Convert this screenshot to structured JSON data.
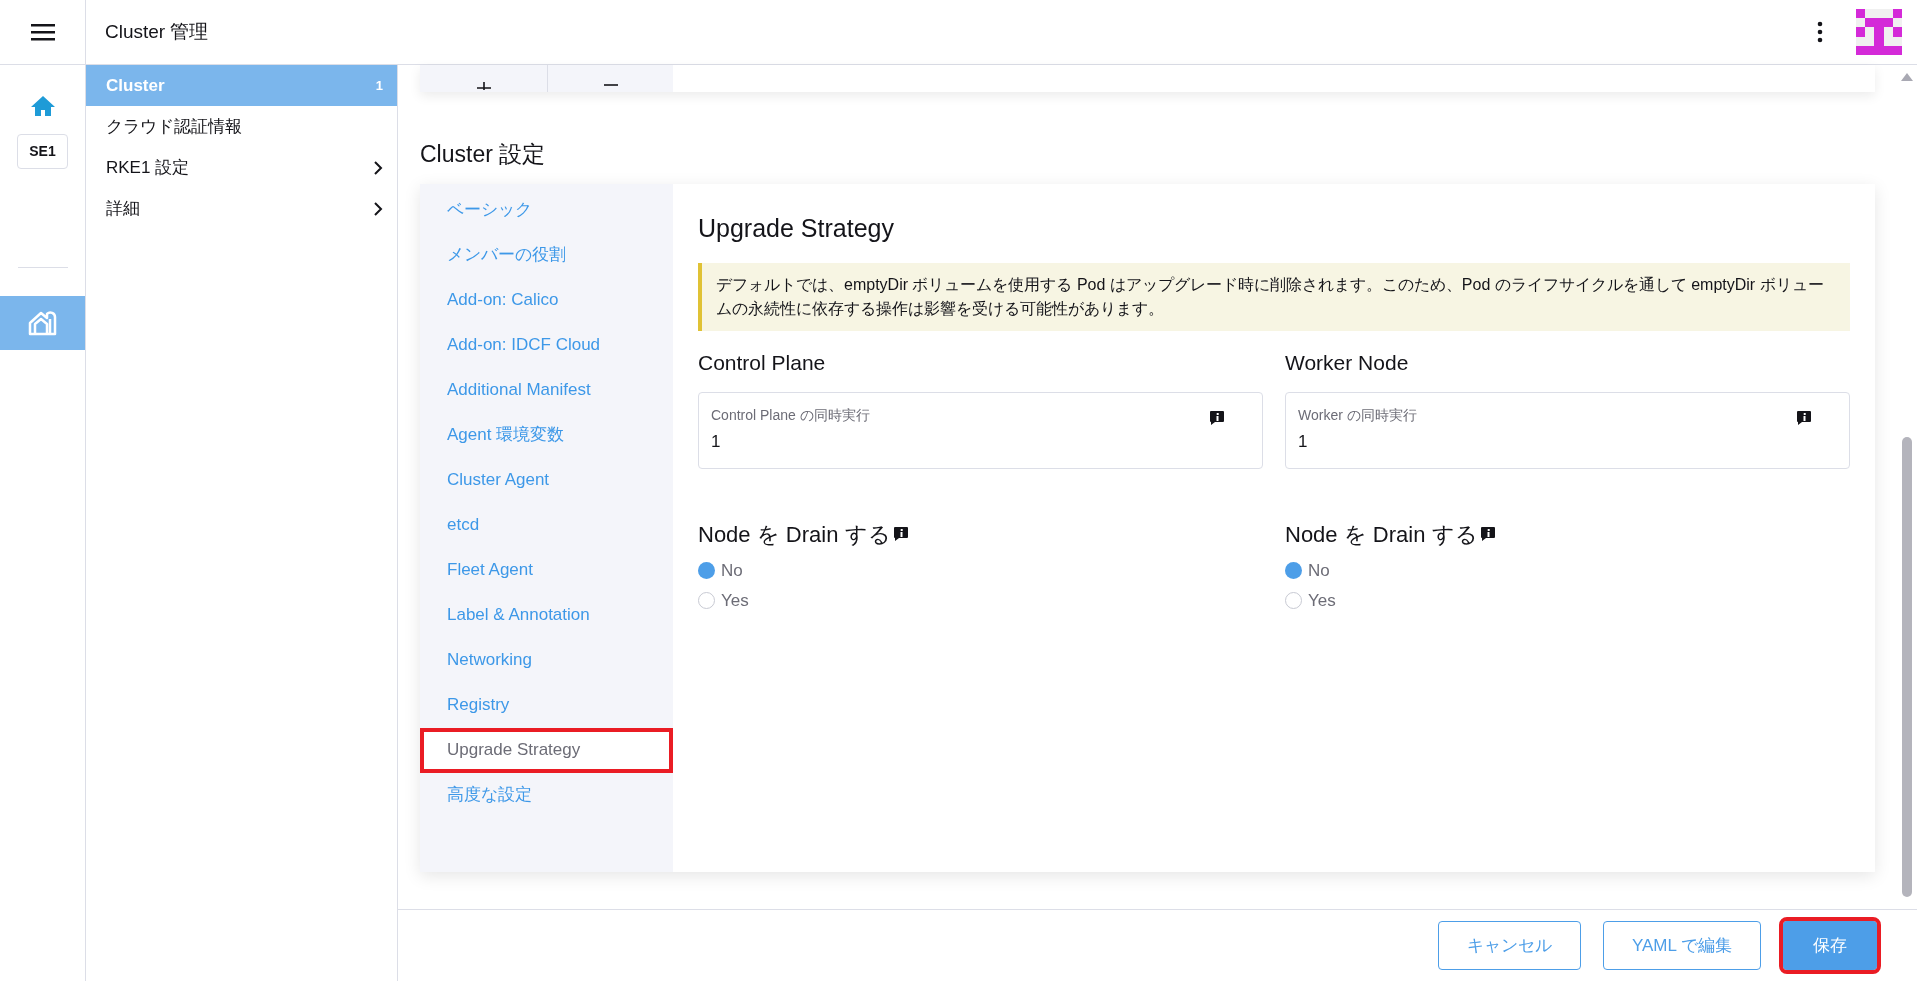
{
  "header": {
    "title": "Cluster 管理"
  },
  "rail": {
    "cluster_badge": "SE1"
  },
  "sidebar": {
    "items": [
      {
        "label": "Cluster",
        "count": "1",
        "selected": true,
        "expandable": false
      },
      {
        "label": "クラウド認証情報",
        "selected": false,
        "expandable": false
      },
      {
        "label": "RKE1 設定",
        "selected": false,
        "expandable": true
      },
      {
        "label": "詳細",
        "selected": false,
        "expandable": true
      }
    ]
  },
  "section_title": "Cluster 設定",
  "settings_nav": [
    {
      "label": "ベーシック",
      "selected": false,
      "highlighted": false
    },
    {
      "label": "メンバーの役割",
      "selected": false,
      "highlighted": false
    },
    {
      "label": "Add-on: Calico",
      "selected": false,
      "highlighted": false
    },
    {
      "label": "Add-on: IDCF Cloud",
      "selected": false,
      "highlighted": false
    },
    {
      "label": "Additional Manifest",
      "selected": false,
      "highlighted": false
    },
    {
      "label": "Agent 環境変数",
      "selected": false,
      "highlighted": false
    },
    {
      "label": "Cluster Agent",
      "selected": false,
      "highlighted": false
    },
    {
      "label": "etcd",
      "selected": false,
      "highlighted": false
    },
    {
      "label": "Fleet Agent",
      "selected": false,
      "highlighted": false
    },
    {
      "label": "Label & Annotation",
      "selected": false,
      "highlighted": false
    },
    {
      "label": "Networking",
      "selected": false,
      "highlighted": false
    },
    {
      "label": "Registry",
      "selected": false,
      "highlighted": false
    },
    {
      "label": "Upgrade Strategy",
      "selected": true,
      "highlighted": true
    },
    {
      "label": "高度な設定",
      "selected": false,
      "highlighted": false
    }
  ],
  "panel": {
    "title": "Upgrade Strategy",
    "banner": "デフォルトでは、emptyDir ボリュームを使用する Pod はアップグレード時に削除されます。このため、Pod のライフサイクルを通して emptyDir ボリュームの永続性に依存する操作は影響を受ける可能性があります。",
    "columns": [
      {
        "heading": "Control Plane",
        "field_label": "Control Plane の同時実行",
        "field_value": "1",
        "drain_title": "Node を Drain する",
        "options": [
          {
            "label": "No",
            "selected": true
          },
          {
            "label": "Yes",
            "selected": false
          }
        ]
      },
      {
        "heading": "Worker Node",
        "field_label": "Worker の同時実行",
        "field_value": "1",
        "drain_title": "Node を Drain する",
        "options": [
          {
            "label": "No",
            "selected": true
          },
          {
            "label": "Yes",
            "selected": false
          }
        ]
      }
    ]
  },
  "footer": {
    "buttons": [
      {
        "label": "キャンセル",
        "kind": "outline",
        "highlighted": false
      },
      {
        "label": "YAML で編集",
        "kind": "outline",
        "highlighted": false
      },
      {
        "label": "保存",
        "kind": "primary",
        "highlighted": true
      }
    ]
  }
}
